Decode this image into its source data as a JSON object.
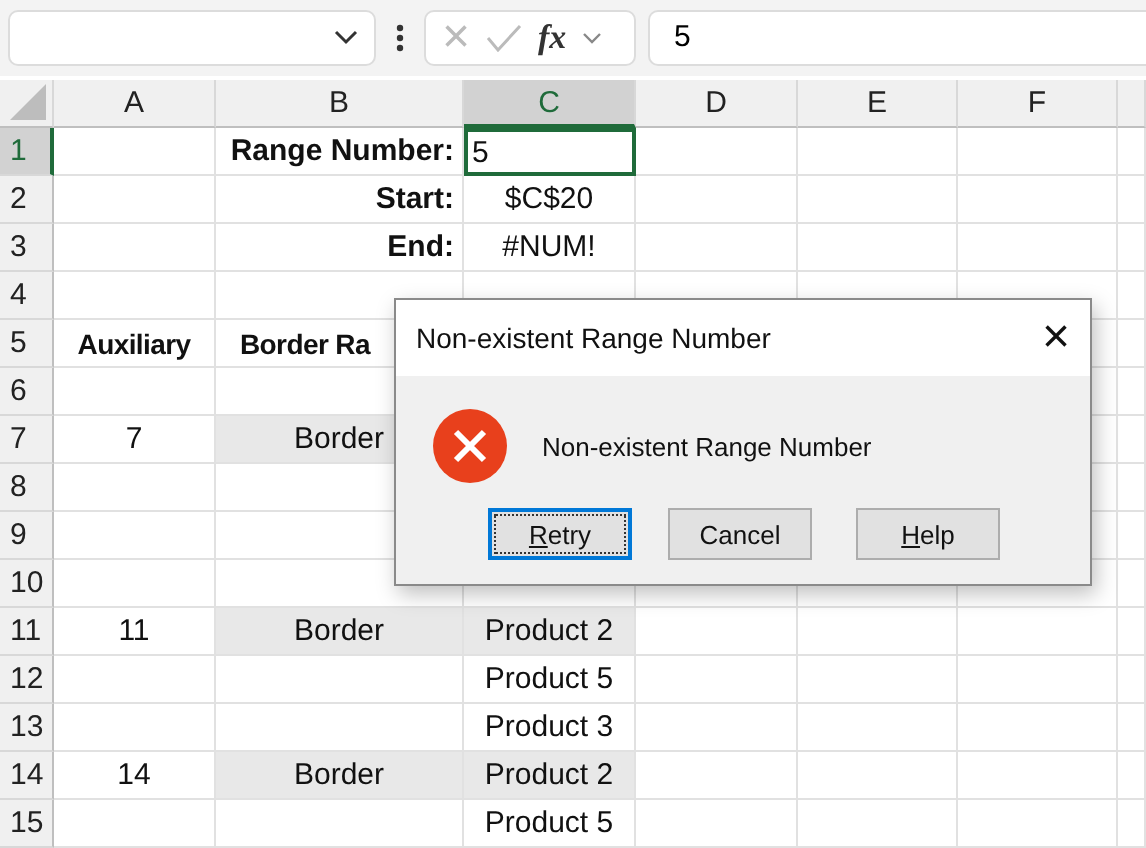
{
  "formula_bar": {
    "formula": "5",
    "cancel_icon": "×",
    "fx": "fx"
  },
  "columns": [
    {
      "label": "A",
      "selected": false
    },
    {
      "label": "B",
      "selected": false
    },
    {
      "label": "C",
      "selected": true
    },
    {
      "label": "D",
      "selected": false
    },
    {
      "label": "E",
      "selected": false
    },
    {
      "label": "F",
      "selected": false
    }
  ],
  "rows": [
    {
      "number": "1",
      "selected": true,
      "cells": [
        null,
        {
          "text": "Range Number:",
          "kind": "label",
          "shaded": false
        },
        {
          "text": "5",
          "kind": "input",
          "shaded": false,
          "selected": true
        }
      ]
    },
    {
      "number": "2",
      "selected": false,
      "cells": [
        null,
        {
          "text": "Start:",
          "kind": "label",
          "shaded": false
        },
        {
          "text": "$C$20",
          "kind": "value",
          "shaded": false
        }
      ]
    },
    {
      "number": "3",
      "selected": false,
      "cells": [
        null,
        {
          "text": "End:",
          "kind": "label",
          "shaded": false
        },
        {
          "text": "#NUM!",
          "kind": "value",
          "shaded": false
        }
      ]
    },
    {
      "number": "4",
      "selected": false,
      "cells": []
    },
    {
      "number": "5",
      "selected": false,
      "cells": [
        {
          "text": "Auxiliary",
          "kind": "header",
          "shaded": false
        },
        {
          "text": "Border Ra",
          "kind": "header",
          "shaded": false
        }
      ]
    },
    {
      "number": "6",
      "selected": false,
      "cells": []
    },
    {
      "number": "7",
      "selected": false,
      "cells": [
        {
          "text": "7",
          "kind": "value",
          "shaded": false
        },
        {
          "text": "Border",
          "kind": "value",
          "shaded": true
        }
      ]
    },
    {
      "number": "8",
      "selected": false,
      "cells": []
    },
    {
      "number": "9",
      "selected": false,
      "cells": []
    },
    {
      "number": "10",
      "selected": false,
      "cells": []
    },
    {
      "number": "11",
      "selected": false,
      "cells": [
        {
          "text": "11",
          "kind": "value",
          "shaded": false
        },
        {
          "text": "Border",
          "kind": "value",
          "shaded": true
        },
        {
          "text": "Product 2",
          "kind": "value",
          "shaded": true
        }
      ]
    },
    {
      "number": "12",
      "selected": false,
      "cells": [
        null,
        null,
        {
          "text": "Product 5",
          "kind": "value",
          "shaded": false
        }
      ]
    },
    {
      "number": "13",
      "selected": false,
      "cells": [
        null,
        null,
        {
          "text": "Product 3",
          "kind": "value",
          "shaded": false
        }
      ]
    },
    {
      "number": "14",
      "selected": false,
      "cells": [
        {
          "text": "14",
          "kind": "value",
          "shaded": false
        },
        {
          "text": "Border",
          "kind": "value",
          "shaded": true
        },
        {
          "text": "Product 2",
          "kind": "value",
          "shaded": true
        }
      ]
    },
    {
      "number": "15",
      "selected": false,
      "cells": [
        null,
        null,
        {
          "text": "Product 5",
          "kind": "value",
          "shaded": false
        }
      ]
    }
  ],
  "dialog": {
    "title": "Non-existent Range Number",
    "close": "×",
    "message": "Non-existent Range Number",
    "buttons": [
      {
        "label": "Retry",
        "mnemonic": true,
        "focused": true
      },
      {
        "label": "Cancel",
        "mnemonic": false,
        "focused": false
      },
      {
        "label": "Help",
        "mnemonic": true,
        "focused": false
      }
    ]
  }
}
